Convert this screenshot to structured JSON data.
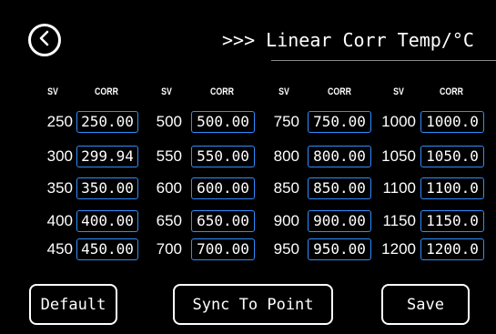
{
  "header": {
    "title": ">>> Linear Corr Temp/°C"
  },
  "columns": {
    "sv_label": "SV",
    "corr_label": "CORR"
  },
  "rows": [
    [
      {
        "sv": "250",
        "corr": "250.00"
      },
      {
        "sv": "500",
        "corr": "500.00"
      },
      {
        "sv": "750",
        "corr": "750.00"
      },
      {
        "sv": "1000",
        "corr": "1000.0"
      }
    ],
    [
      {
        "sv": "300",
        "corr": "299.94"
      },
      {
        "sv": "550",
        "corr": "550.00"
      },
      {
        "sv": "800",
        "corr": "800.00"
      },
      {
        "sv": "1050",
        "corr": "1050.0"
      }
    ],
    [
      {
        "sv": "350",
        "corr": "350.00"
      },
      {
        "sv": "600",
        "corr": "600.00"
      },
      {
        "sv": "850",
        "corr": "850.00"
      },
      {
        "sv": "1100",
        "corr": "1100.0"
      }
    ],
    [
      {
        "sv": "400",
        "corr": "400.00"
      },
      {
        "sv": "650",
        "corr": "650.00"
      },
      {
        "sv": "900",
        "corr": "900.00"
      },
      {
        "sv": "1150",
        "corr": "1150.0"
      }
    ],
    [
      {
        "sv": "450",
        "corr": "450.00"
      },
      {
        "sv": "700",
        "corr": "700.00"
      },
      {
        "sv": "950",
        "corr": "950.00"
      },
      {
        "sv": "1200",
        "corr": "1200.0"
      }
    ]
  ],
  "buttons": {
    "default_label": "Default",
    "sync_label": "Sync To Point",
    "save_label": "Save"
  },
  "colors": {
    "background": "#000000",
    "text": "#ffffff",
    "input_border": "#2f8dff"
  },
  "icons": {
    "back": "chevron-left-icon"
  }
}
